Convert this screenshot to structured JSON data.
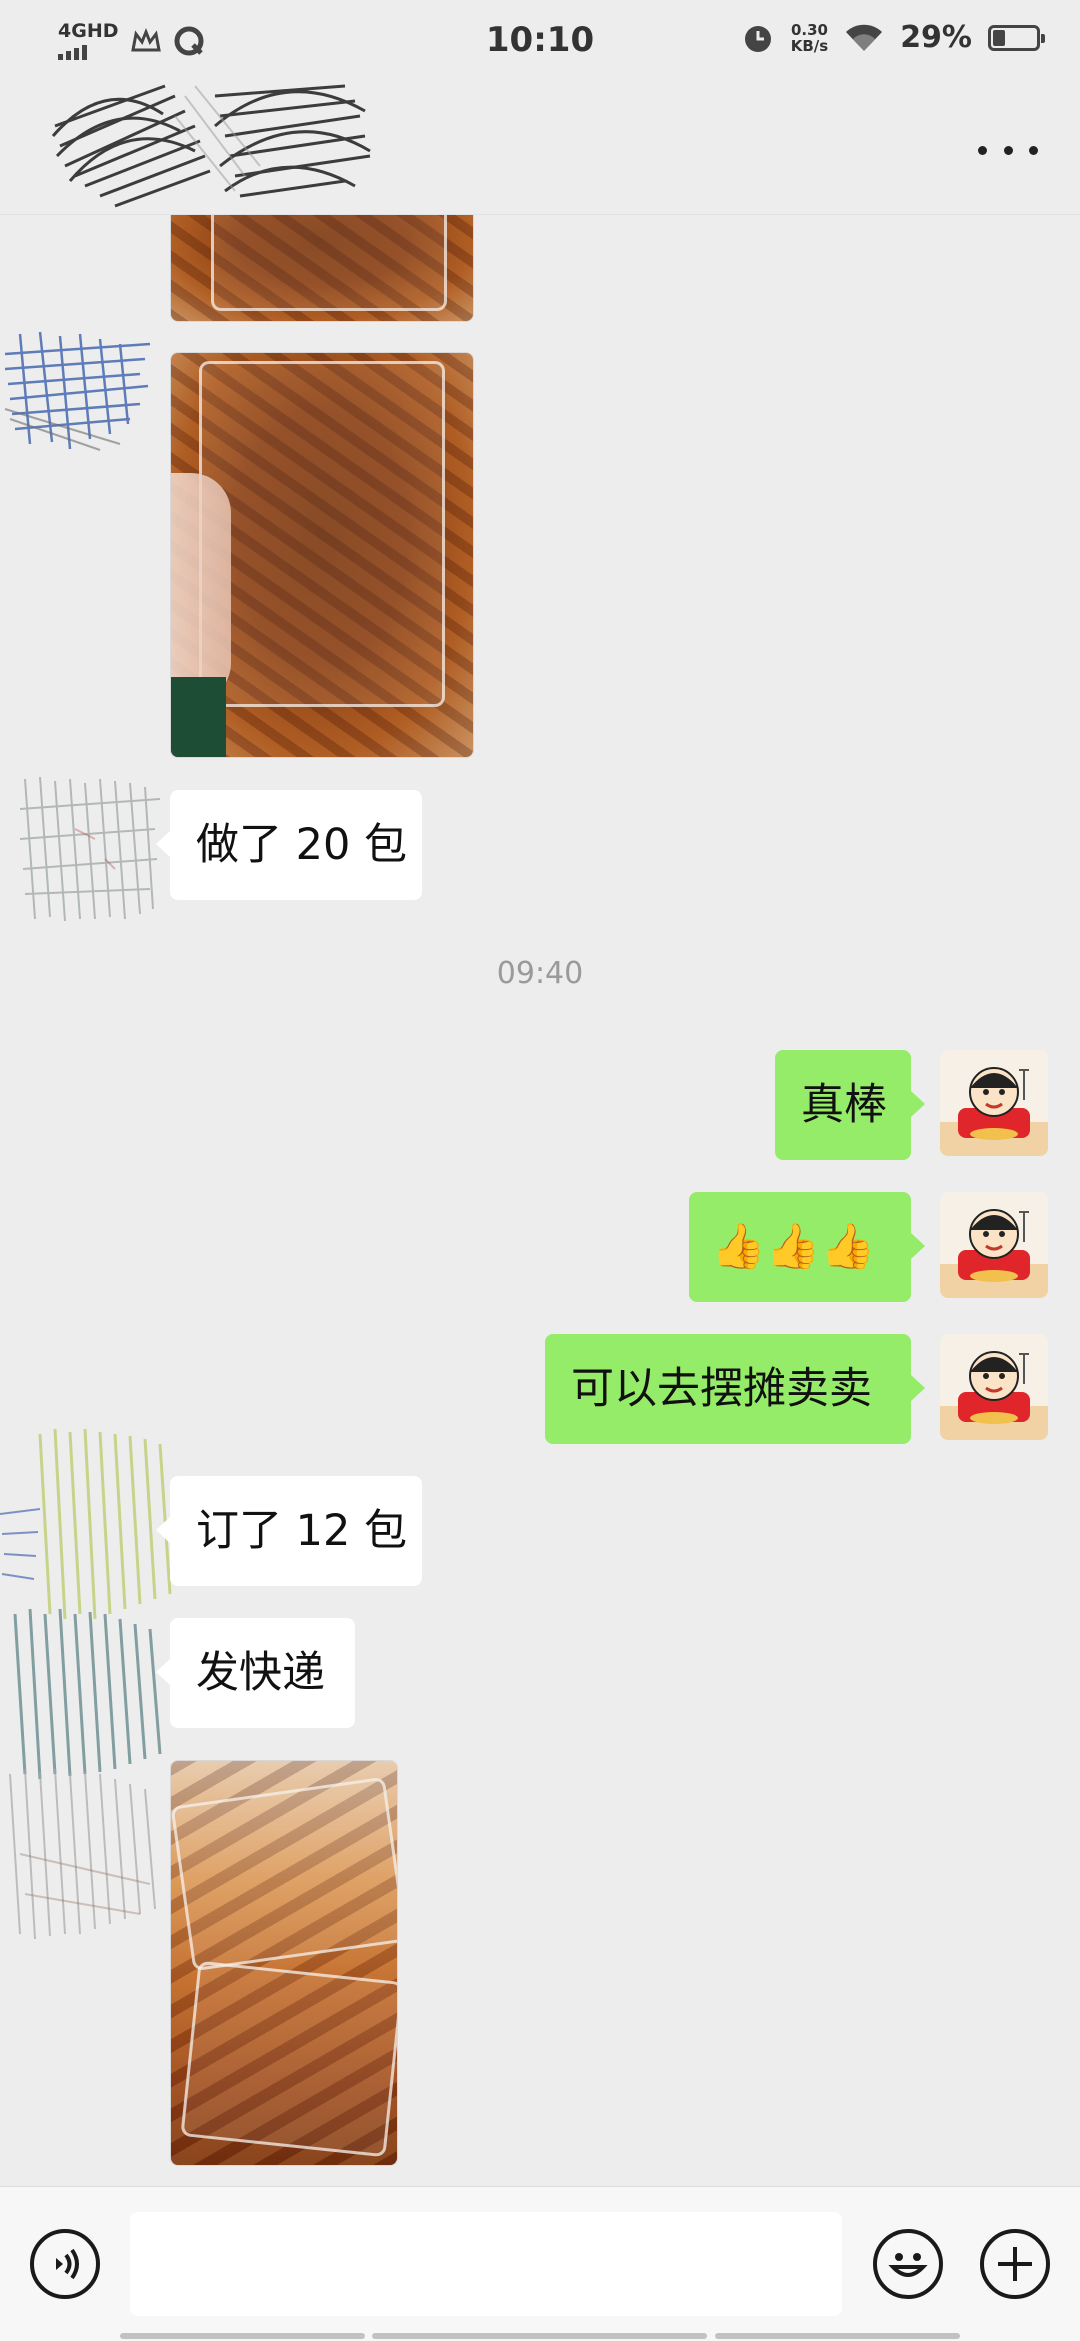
{
  "status_bar": {
    "network": "4GHD",
    "time": "10:10",
    "net_speed_value": "0.30",
    "net_speed_unit": "KB/s",
    "battery": "29%",
    "battery_level": 0.29
  },
  "header": {
    "more_icon": "more-horizontal-icon"
  },
  "messages": {
    "m1": "做了 20 包",
    "timestamp": "09:40",
    "m2": "真棒",
    "m3": "👍👍👍",
    "m4": "可以去摆摊卖卖",
    "m5": "订了 12 包",
    "m6": "发快递"
  },
  "input": {
    "voice_icon": "voice-icon",
    "emoji_icon": "emoji-icon",
    "plus_icon": "plus-icon",
    "value": ""
  },
  "colors": {
    "background": "#ededed",
    "sent_bubble": "#95ec69",
    "received_bubble": "#ffffff"
  }
}
